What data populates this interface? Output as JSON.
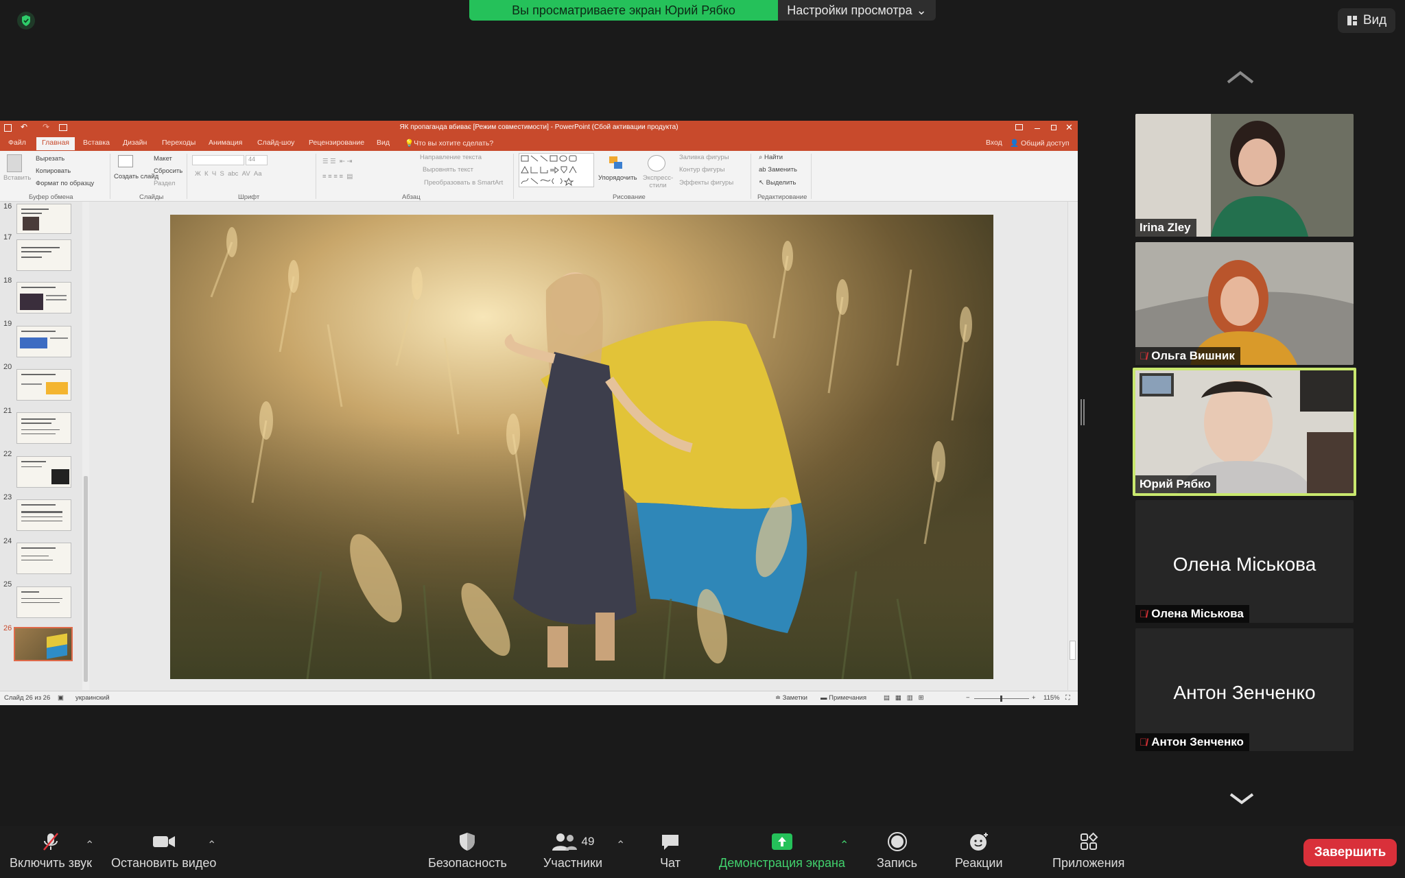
{
  "banner": {
    "viewing_text": "Вы просматриваете экран Юрий Рябко",
    "settings_label": "Настройки просмотра"
  },
  "view_button": {
    "label": "Вид"
  },
  "ppt": {
    "window_title": "ЯК пропаганда вбиває [Режим совместимости] - PowerPoint (Сбой активации продукта)",
    "tabs": [
      "Файл",
      "Главная",
      "Вставка",
      "Дизайн",
      "Переходы",
      "Анимация",
      "Слайд-шоу",
      "Рецензирование",
      "Вид"
    ],
    "tell_me": "Что вы хотите сделать?",
    "signin": "Вход",
    "share": "Общий доступ",
    "ribbon": {
      "paste": "Вставить",
      "cut": "Вырезать",
      "copy": "Копировать",
      "format_painter": "Формат по образцу",
      "clipboard_group": "Буфер обмена",
      "layout": "Макет",
      "reset": "Сбросить",
      "section": "Раздел",
      "new_slide": "Создать слайд",
      "slides_group": "Слайды",
      "font_size": "44",
      "font_group": "Шрифт",
      "text_direction": "Направление текста",
      "align_text": "Выровнять текст",
      "convert_smartart": "Преобразовать в SmartArt",
      "paragraph_group": "Абзац",
      "arrange": "Упорядочить",
      "quick_styles": "Экспресс-стили",
      "shape_fill": "Заливка фигуры",
      "shape_outline": "Контур фигуры",
      "shape_effects": "Эффекты фигуры",
      "drawing_group": "Рисование",
      "find": "Найти",
      "replace": "Заменить",
      "select": "Выделить",
      "editing_group": "Редактирование"
    },
    "slide_numbers": [
      "16",
      "17",
      "18",
      "19",
      "20",
      "21",
      "22",
      "23",
      "24",
      "25",
      "26"
    ],
    "status": {
      "slide_count": "Слайд 26 из 26",
      "language": "украинский",
      "notes": "Заметки",
      "comments": "Примечания",
      "zoom": "115%"
    }
  },
  "participants": [
    {
      "name": "Irina Zley",
      "muted": false,
      "video": true
    },
    {
      "name": "Ольга Вишник",
      "muted": true,
      "video": true
    },
    {
      "name": "Юрий Рябко",
      "muted": false,
      "video": true,
      "active_speaker": true
    },
    {
      "name": "Олена Міськова",
      "muted": true,
      "video": false,
      "display_name": "Олена Міськова"
    },
    {
      "name": "Антон Зенченко",
      "muted": true,
      "video": false,
      "display_name": "Антон Зенченко"
    }
  ],
  "toolbar": {
    "unmute": "Включить звук",
    "stop_video": "Остановить видео",
    "security": "Безопасность",
    "participants": "Участники",
    "participants_count": "49",
    "chat": "Чат",
    "share_screen": "Демонстрация экрана",
    "record": "Запись",
    "reactions": "Реакции",
    "apps": "Приложения",
    "end": "Завершить"
  },
  "colors": {
    "accent_green": "#25c15a",
    "ppt_orange": "#c84a2c",
    "end_red": "#d9303a",
    "active_border": "#c9e86e"
  }
}
